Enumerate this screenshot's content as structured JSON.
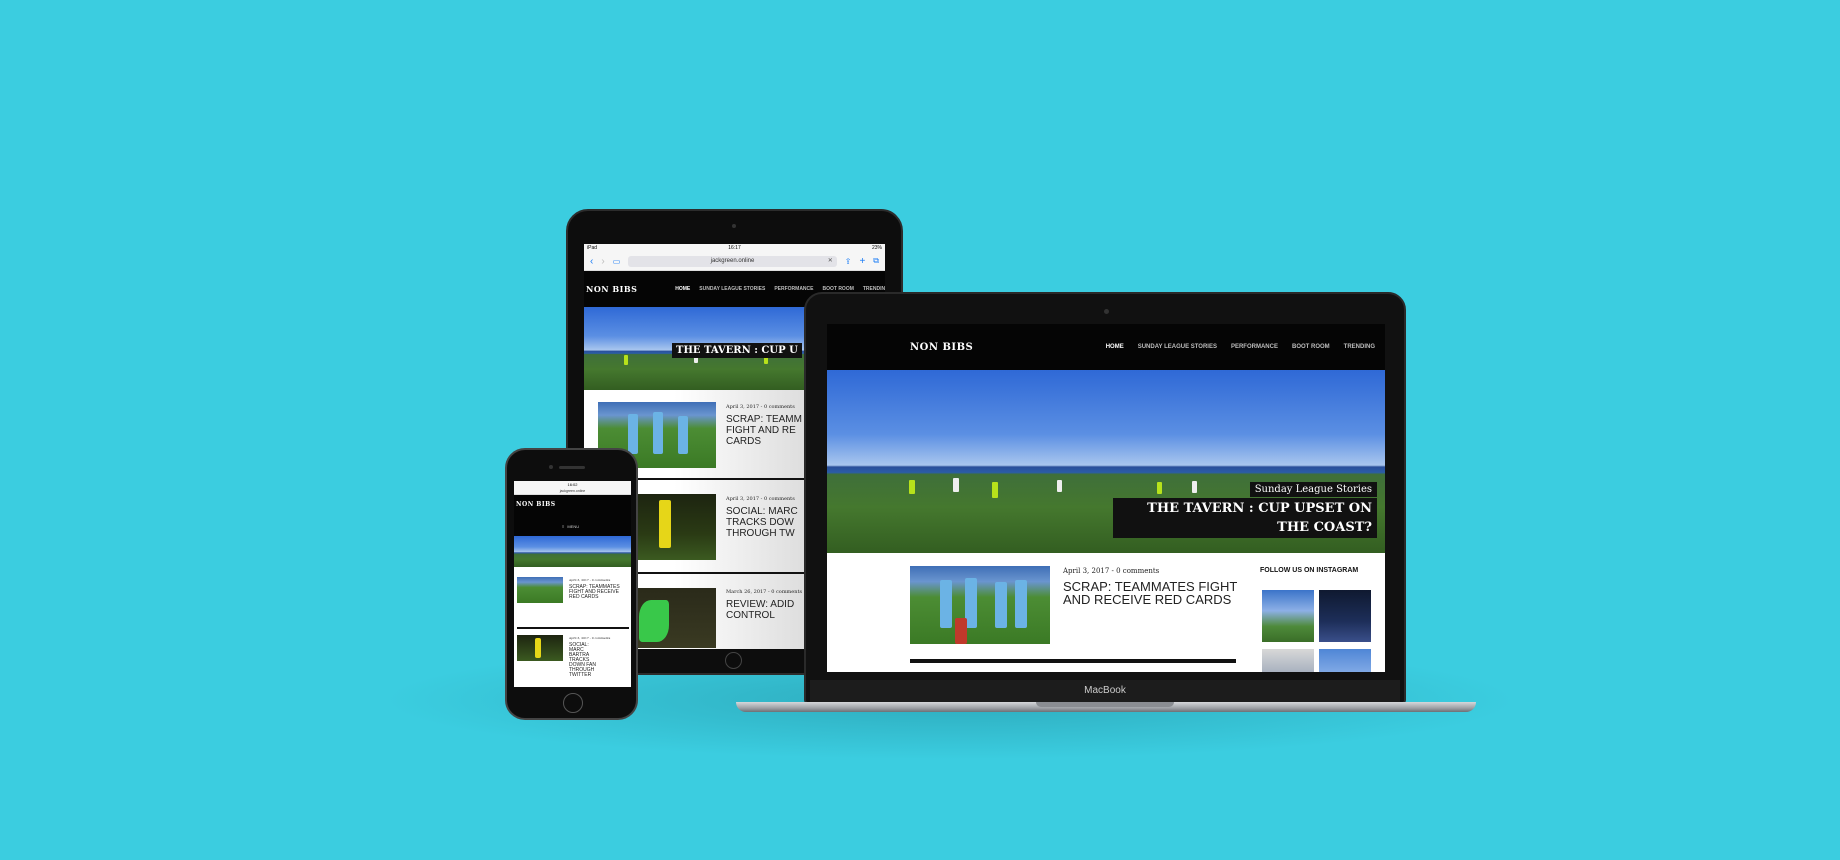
{
  "site": {
    "logo": "NON BIBS",
    "nav": [
      "HOME",
      "SUNDAY LEAGUE STORIES",
      "PERFORMANCE",
      "BOOT ROOM",
      "TRENDING"
    ],
    "hero_category": "Sunday League Stories",
    "hero_title": "THE TAVERN : CUP UPSET ON THE COAST?",
    "hero_title_tablet": "THE TAVERN : CUP U",
    "menu_label": "MENU",
    "instagram_heading": "FOLLOW US ON INSTAGRAM",
    "articles": [
      {
        "meta": "April 3, 2017 - 0 comments",
        "title": "SCRAP: TEAMMATES FIGHT AND RECEIVE RED CARDS"
      },
      {
        "meta": "April 3, 2017 - 0 comments",
        "title": "SOCIAL: MARC BARTRA TRACKS DOWN FAN THROUGH TWITTER"
      },
      {
        "meta": "March 26, 2017 - 0 comments",
        "title": "REVIEW: ADIDAS CONTROL"
      }
    ],
    "tablet_titles": [
      "SCRAP: TEAMM FIGHT AND RE CARDS",
      "SOCIAL: MARC TRACKS DOW THROUGH TW",
      "REVIEW: ADID CONTROL"
    ]
  },
  "laptop": {
    "brand": "MacBook"
  },
  "tablet": {
    "status_left": "iPad",
    "status_time": "16:17",
    "status_right": "23%",
    "url": "jackgreen.online"
  },
  "phone": {
    "status_time": "16:02",
    "url": "jackgreen.online"
  },
  "colors": {
    "background": "#3bcde0",
    "nav_bg": "#050505",
    "accent_text": "#ffffff"
  }
}
